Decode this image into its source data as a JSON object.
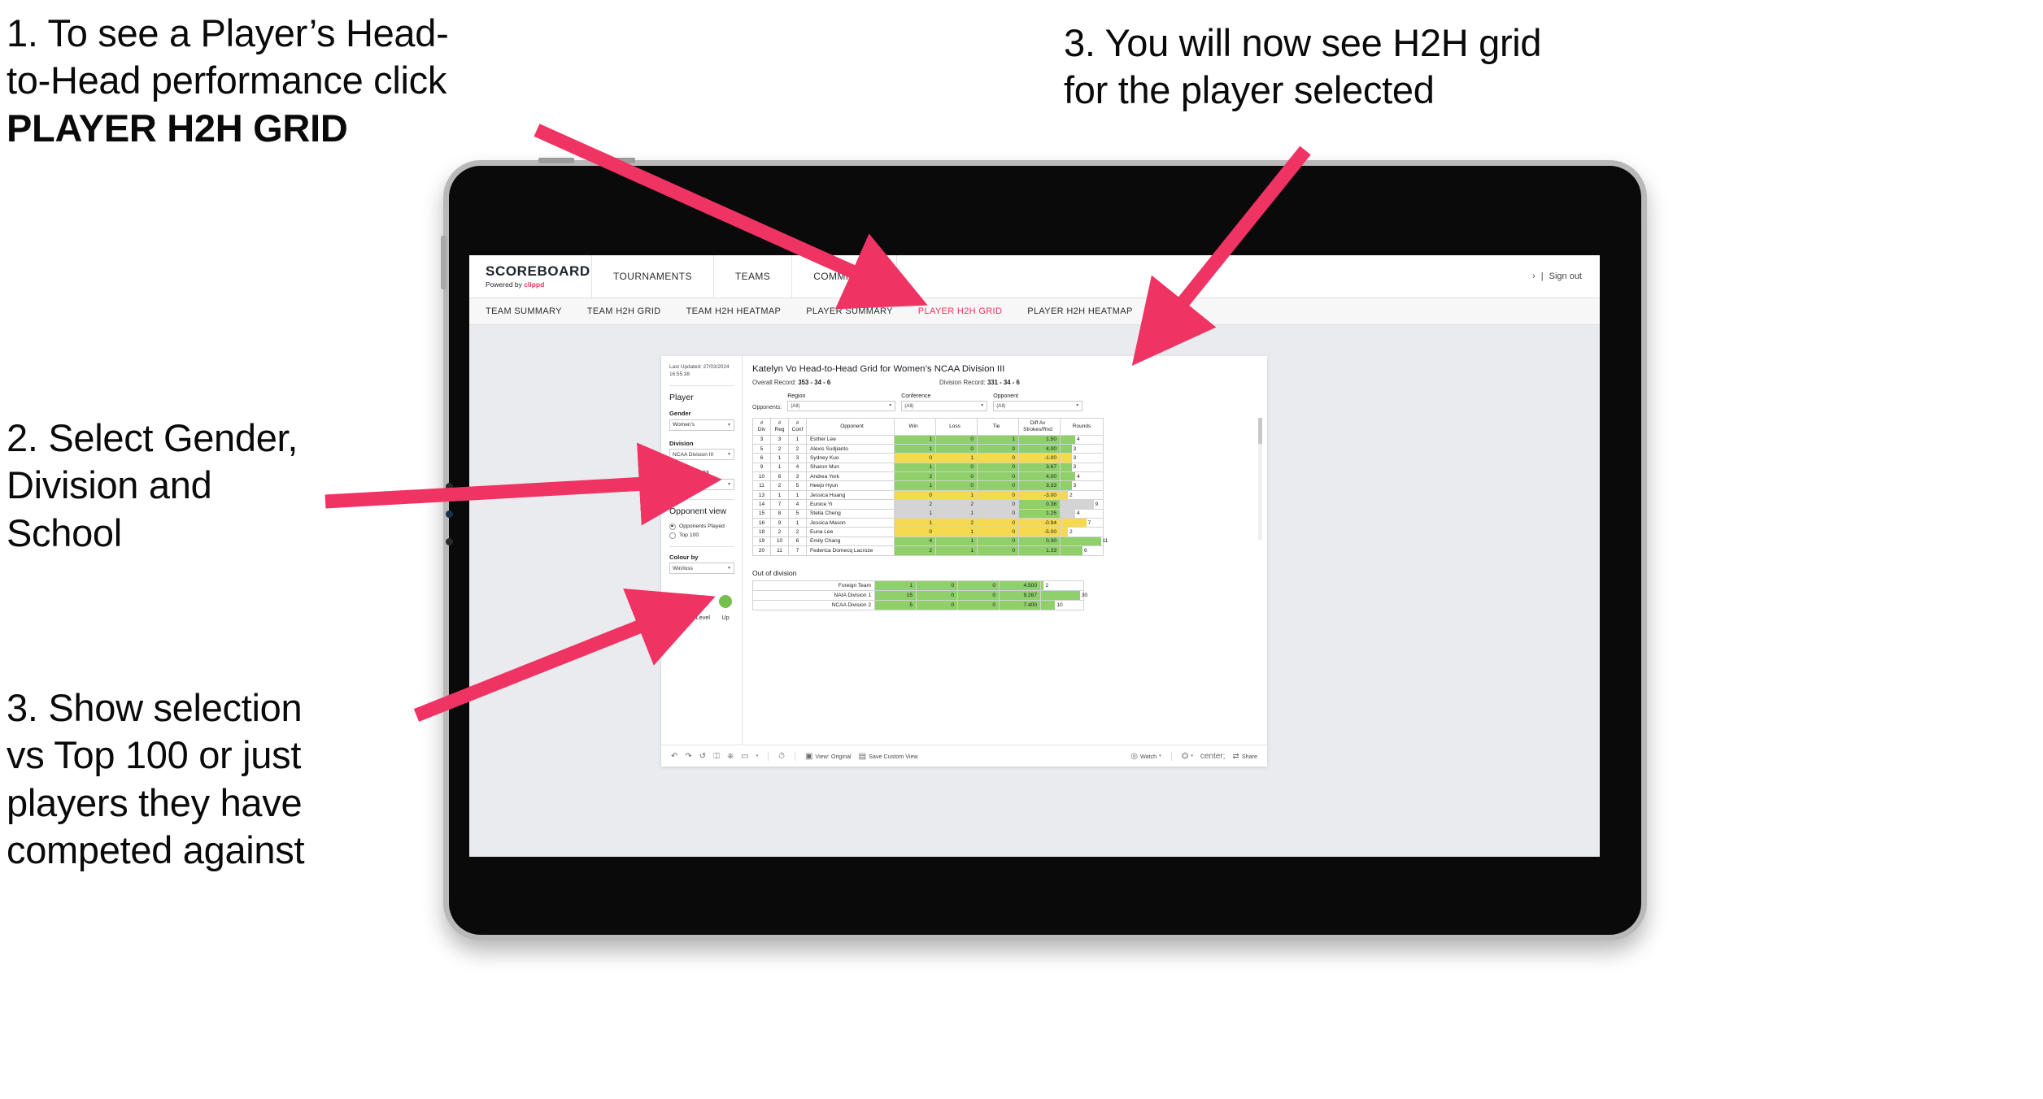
{
  "annotations": {
    "step1_line1": "1. To see a Player’s Head-",
    "step1_line2": "to-Head performance click",
    "step1_bold": "PLAYER H2H GRID",
    "step2_line1": "2. Select Gender,",
    "step2_line2": "Division and",
    "step2_line3": "School",
    "step3_line1": "3. Show selection",
    "step3_line2": "vs Top 100 or just",
    "step3_line3": "players they have",
    "step3_line4": "competed against",
    "step4_line1": "3. You will now see H2H grid",
    "step4_line2": "for the player selected",
    "arrow_color": "#ef3363"
  },
  "app": {
    "brand": {
      "name": "SCOREBOARD",
      "powered_prefix": "Powered by ",
      "powered_brand": "clippd"
    },
    "nav": [
      "TOURNAMENTS",
      "TEAMS",
      "COMMITTEE"
    ],
    "account": {
      "chevron": "›",
      "divider": "|",
      "sign_out": "Sign out"
    },
    "tabs": [
      {
        "label": "TEAM SUMMARY",
        "active": false
      },
      {
        "label": "TEAM H2H GRID",
        "active": false
      },
      {
        "label": "TEAM H2H HEATMAP",
        "active": false
      },
      {
        "label": "PLAYER SUMMARY",
        "active": false
      },
      {
        "label": "PLAYER H2H GRID",
        "active": true
      },
      {
        "label": "PLAYER H2H HEATMAP",
        "active": false
      }
    ],
    "active_tab_color": "#e8335c"
  },
  "sidebar": {
    "last_updated_line1": "Last Updated: 27/03/2024",
    "last_updated_line2": "16:55:38",
    "player_section_title": "Player",
    "fields": [
      {
        "label": "Gender",
        "value": "Women's"
      },
      {
        "label": "Division",
        "value": "NCAA Division III"
      },
      {
        "label": "Player (Rank)",
        "value": "8. Katelyn Vo"
      }
    ],
    "opponent_view_title": "Opponent view",
    "opponent_view_options": [
      {
        "label": "Opponents Played",
        "selected": true
      },
      {
        "label": "Top 100",
        "selected": false
      }
    ],
    "colour_by_label": "Colour by",
    "colour_by_value": "Win/loss",
    "legend": [
      {
        "label": "Down",
        "color": "#f5d44a"
      },
      {
        "label": "Level",
        "color": "#bcbcbc"
      },
      {
        "label": "Up",
        "color": "#76bf4d"
      }
    ]
  },
  "main": {
    "title": "Katelyn Vo Head-to-Head Grid for Women’s NCAA Division III",
    "overall_record_label": "Overall Record: ",
    "overall_record_value": "353 -  34 - 6",
    "division_record_label": "Division Record: ",
    "division_record_value": "331 -  34 - 6",
    "opponents_label": "Opponents:",
    "filters": [
      {
        "label": "Region",
        "value": "(All)"
      },
      {
        "label": "Conference",
        "value": "(All)"
      },
      {
        "label": "Opponent",
        "value": "(All)"
      }
    ],
    "out_of_division_title": "Out of division"
  },
  "chart_data": {
    "type": "table",
    "title": "Katelyn Vo Head-to-Head Grid for Women’s NCAA Division III",
    "columns": [
      "# Div",
      "# Reg",
      "# Conf",
      "Opponent",
      "Win",
      "Loss",
      "Tie",
      "Diff Av Strokes/Rnd",
      "Rounds"
    ],
    "column_headers_two_line": {
      "div": {
        "top": "#",
        "bottom": "Div"
      },
      "reg": {
        "top": "#",
        "bottom": "Reg"
      },
      "conf": {
        "top": "#",
        "bottom": "Conf"
      },
      "opponent": "Opponent",
      "win": "Win",
      "loss": "Loss",
      "tie": "Tie",
      "diff": {
        "top": "Diff Av",
        "bottom": "Strokes/Rnd"
      },
      "rounds": "Rounds"
    },
    "colors": {
      "up": "#8fd06a",
      "down": "#f5d94f",
      "level": "#d4d4d4"
    },
    "rounds_max": 30,
    "rows": [
      {
        "div": "3",
        "reg": "3",
        "conf": "1",
        "opponent": "Esther Lee",
        "win": "1",
        "loss": "0",
        "tie": "1",
        "diff": "1.50",
        "rounds": "4",
        "state": "up"
      },
      {
        "div": "5",
        "reg": "2",
        "conf": "2",
        "opponent": "Alexis Sudjianto",
        "win": "1",
        "loss": "0",
        "tie": "0",
        "diff": "4.00",
        "rounds": "3",
        "state": "up"
      },
      {
        "div": "6",
        "reg": "1",
        "conf": "3",
        "opponent": "Sydney Kuo",
        "win": "0",
        "loss": "1",
        "tie": "0",
        "diff": "-1.00",
        "rounds": "3",
        "state": "down"
      },
      {
        "div": "9",
        "reg": "1",
        "conf": "4",
        "opponent": "Sharon Mun",
        "win": "1",
        "loss": "0",
        "tie": "0",
        "diff": "3.67",
        "rounds": "3",
        "state": "up"
      },
      {
        "div": "10",
        "reg": "6",
        "conf": "3",
        "opponent": "Andrea York",
        "win": "2",
        "loss": "0",
        "tie": "0",
        "diff": "4.00",
        "rounds": "4",
        "state": "up"
      },
      {
        "div": "11",
        "reg": "2",
        "conf": "5",
        "opponent": "Heejo Hyun",
        "win": "1",
        "loss": "0",
        "tie": "0",
        "diff": "3.33",
        "rounds": "3",
        "state": "up"
      },
      {
        "div": "13",
        "reg": "1",
        "conf": "1",
        "opponent": "Jessica Huang",
        "win": "0",
        "loss": "1",
        "tie": "0",
        "diff": "-3.00",
        "rounds": "2",
        "state": "down"
      },
      {
        "div": "14",
        "reg": "7",
        "conf": "4",
        "opponent": "Eunice Yi",
        "win": "2",
        "loss": "2",
        "tie": "0",
        "diff": "0.38",
        "rounds": "9",
        "state": "level",
        "diff_state": "up"
      },
      {
        "div": "15",
        "reg": "8",
        "conf": "5",
        "opponent": "Stella Cheng",
        "win": "1",
        "loss": "1",
        "tie": "0",
        "diff": "1.25",
        "rounds": "4",
        "state": "level",
        "diff_state": "up"
      },
      {
        "div": "16",
        "reg": "9",
        "conf": "1",
        "opponent": "Jessica Mason",
        "win": "1",
        "loss": "2",
        "tie": "0",
        "diff": "-0.94",
        "rounds": "7",
        "state": "down"
      },
      {
        "div": "18",
        "reg": "2",
        "conf": "2",
        "opponent": "Euna Lee",
        "win": "0",
        "loss": "1",
        "tie": "0",
        "diff": "-5.00",
        "rounds": "2",
        "state": "down"
      },
      {
        "div": "19",
        "reg": "10",
        "conf": "6",
        "opponent": "Emily Chang",
        "win": "4",
        "loss": "1",
        "tie": "0",
        "diff": "0.30",
        "rounds": "11",
        "state": "up"
      },
      {
        "div": "20",
        "reg": "11",
        "conf": "7",
        "opponent": "Federica Domecq Lacroze",
        "win": "2",
        "loss": "1",
        "tie": "0",
        "diff": "1.33",
        "rounds": "6",
        "state": "up"
      }
    ],
    "out_of_division": {
      "title": "Out of division",
      "rows": [
        {
          "name": "Foreign Team",
          "win": "1",
          "loss": "0",
          "tie": "0",
          "diff": "4.500",
          "rounds": "2",
          "state": "up"
        },
        {
          "name": "NAIA Division 1",
          "win": "15",
          "loss": "0",
          "tie": "0",
          "diff": "9.267",
          "rounds": "30",
          "state": "up"
        },
        {
          "name": "NCAA Division 2",
          "win": "5",
          "loss": "0",
          "tie": "0",
          "diff": "7.400",
          "rounds": "10",
          "state": "up"
        }
      ]
    }
  },
  "toolbar": {
    "view_label": "View: Original",
    "save_label": "Save Custom View",
    "watch_label": "Watch",
    "share_label": "Share",
    "caret": "▾"
  }
}
